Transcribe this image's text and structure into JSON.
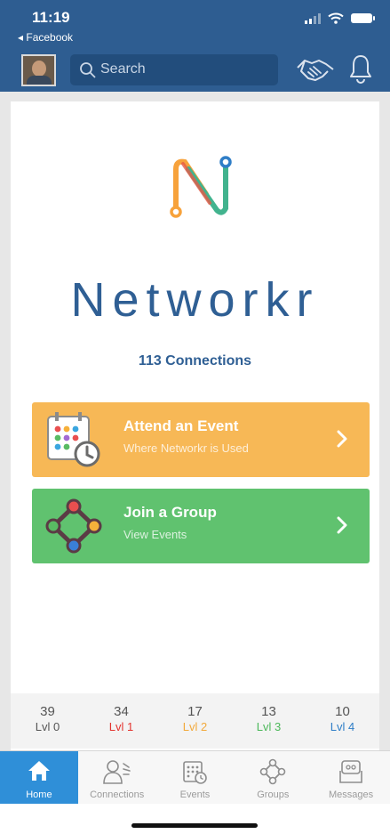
{
  "status": {
    "time": "11:19",
    "back_app": "Facebook"
  },
  "header": {
    "search_placeholder": "Search"
  },
  "brand": {
    "name": "Networkr",
    "connections": "113 Connections"
  },
  "actions": [
    {
      "title": "Attend an Event",
      "subtitle": "Where Networkr is Used"
    },
    {
      "title": "Join a Group",
      "subtitle": "View Events"
    }
  ],
  "levels": [
    {
      "count": "39",
      "label": "Lvl 0",
      "color": "#555555"
    },
    {
      "count": "34",
      "label": "Lvl 1",
      "color": "#e3342f"
    },
    {
      "count": "17",
      "label": "Lvl 2",
      "color": "#f2a93b"
    },
    {
      "count": "13",
      "label": "Lvl 3",
      "color": "#4cb85a"
    },
    {
      "count": "10",
      "label": "Lvl 4",
      "color": "#2f7ec7"
    }
  ],
  "tabs": [
    {
      "label": "Home",
      "icon": "home-icon",
      "active": true
    },
    {
      "label": "Connections",
      "icon": "connections-icon",
      "active": false
    },
    {
      "label": "Events",
      "icon": "calendar-icon",
      "active": false
    },
    {
      "label": "Groups",
      "icon": "groups-icon",
      "active": false
    },
    {
      "label": "Messages",
      "icon": "messages-icon",
      "active": false
    }
  ],
  "colors": {
    "header": "#2e5d91",
    "event": "#f7b856",
    "group": "#60c26f",
    "active_tab": "#2f8fd8"
  }
}
